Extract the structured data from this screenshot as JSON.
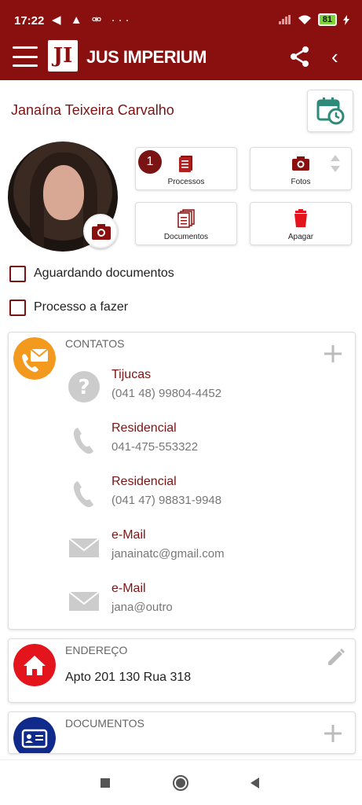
{
  "status_bar": {
    "time": "17:22",
    "left_icons": "◀ ▲ ⚮ ···",
    "battery": "81",
    "bg_color": "#8a1010"
  },
  "header": {
    "logo_mark": "JI",
    "app_name": "JUS IMPERIUM",
    "menu_icon": "hamburger-icon",
    "share_icon": "share-icon",
    "back_icon": "chevron-left-icon",
    "back_glyph": "‹"
  },
  "client": {
    "name": "Janaína Teixeira Carvalho"
  },
  "actions": {
    "processos": {
      "label": "Processos",
      "count": "1"
    },
    "fotos": {
      "label": "Fotos"
    },
    "documentos": {
      "label": "Documentos"
    },
    "apagar": {
      "label": "Apagar"
    }
  },
  "checkboxes": [
    {
      "label": "Aguardando documentos",
      "checked": false
    },
    {
      "label": "Processo a fazer",
      "checked": false
    }
  ],
  "contatos": {
    "title": "CONTATOS",
    "items": [
      {
        "label": "Tijucas",
        "value": "(041 48) 99804-4452",
        "icon": "question-icon"
      },
      {
        "label": "Residencial",
        "value": "041-475-553322",
        "icon": "phone-icon"
      },
      {
        "label": "Residencial",
        "value": "(041 47) 98831-9948",
        "icon": "phone-icon"
      },
      {
        "label": "e-Mail",
        "value": "janainatc@gmail.com",
        "icon": "mail-icon"
      },
      {
        "label": "e-Mail",
        "value": "jana@outro",
        "icon": "mail-icon"
      }
    ]
  },
  "endereco": {
    "title": "ENDEREÇO",
    "value": "Apto 201 130 Rua 318"
  },
  "documentos": {
    "title": "DOCUMENTOS"
  },
  "colors": {
    "brand": "#8a1010",
    "accent_label": "#7a1414",
    "contacts_icon": "#f39a1e",
    "address_icon": "#e3141b",
    "documents_icon": "#0f2a8a"
  }
}
